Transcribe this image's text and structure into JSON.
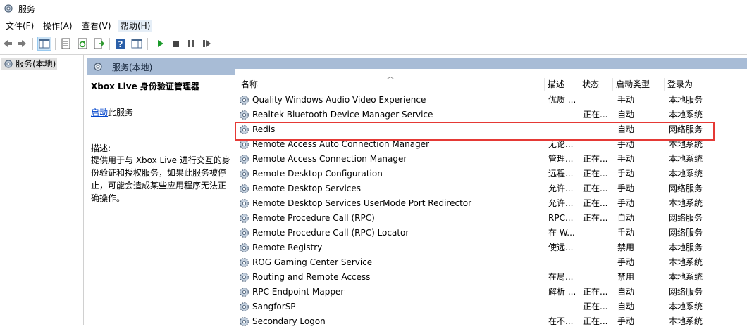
{
  "window": {
    "title": "服务"
  },
  "menu": [
    {
      "label": "文件(F)"
    },
    {
      "label": "操作(A)"
    },
    {
      "label": "查看(V)"
    },
    {
      "label": "帮助(H)"
    }
  ],
  "toolbar": {
    "icons": [
      "back-arrow-icon",
      "forward-arrow-icon",
      "console-tree-icon",
      "properties-icon",
      "refresh-icon",
      "export-list-icon",
      "help-icon",
      "show-pane-icon",
      "start-icon",
      "stop-icon",
      "pause-icon",
      "restart-icon"
    ]
  },
  "tree": {
    "item_label": "服务(本地)"
  },
  "main_header": {
    "label": "服务(本地)"
  },
  "description_panel": {
    "service_title": "Xbox Live 身份验证管理器",
    "start_link": "启动",
    "start_suffix": "此服务",
    "desc_label": "描述:",
    "desc_text": "提供用于与 Xbox Live 进行交互的身份验证和授权服务，如果此服务被停止，可能会造成某些应用程序无法正确操作。"
  },
  "columns": {
    "name": "名称",
    "desc": "描述",
    "status": "状态",
    "startup": "启动类型",
    "logon": "登录为"
  },
  "services": [
    {
      "name": "Quality Windows Audio Video Experience",
      "desc": "优质 ...",
      "status": "",
      "startup": "手动",
      "logon": "本地服务"
    },
    {
      "name": "Realtek Bluetooth Device Manager Service",
      "desc": "",
      "status": "正在...",
      "startup": "自动",
      "logon": "本地系统"
    },
    {
      "name": "Redis",
      "desc": "",
      "status": "",
      "startup": "自动",
      "logon": "网络服务"
    },
    {
      "name": "Remote Access Auto Connection Manager",
      "desc": "无论...",
      "status": "",
      "startup": "手动",
      "logon": "本地系统"
    },
    {
      "name": "Remote Access Connection Manager",
      "desc": "管理...",
      "status": "正在...",
      "startup": "手动",
      "logon": "本地系统"
    },
    {
      "name": "Remote Desktop Configuration",
      "desc": "远程...",
      "status": "正在...",
      "startup": "手动",
      "logon": "本地系统"
    },
    {
      "name": "Remote Desktop Services",
      "desc": "允许...",
      "status": "正在...",
      "startup": "手动",
      "logon": "网络服务"
    },
    {
      "name": "Remote Desktop Services UserMode Port Redirector",
      "desc": "允许...",
      "status": "正在...",
      "startup": "手动",
      "logon": "本地系统"
    },
    {
      "name": "Remote Procedure Call (RPC)",
      "desc": "RPC...",
      "status": "正在...",
      "startup": "自动",
      "logon": "网络服务"
    },
    {
      "name": "Remote Procedure Call (RPC) Locator",
      "desc": "在 W...",
      "status": "",
      "startup": "手动",
      "logon": "网络服务"
    },
    {
      "name": "Remote Registry",
      "desc": "使远...",
      "status": "",
      "startup": "禁用",
      "logon": "本地服务"
    },
    {
      "name": "ROG Gaming Center Service",
      "desc": "",
      "status": "",
      "startup": "手动",
      "logon": "本地系统"
    },
    {
      "name": "Routing and Remote Access",
      "desc": "在局...",
      "status": "",
      "startup": "禁用",
      "logon": "本地系统"
    },
    {
      "name": "RPC Endpoint Mapper",
      "desc": "解析 ...",
      "status": "正在...",
      "startup": "自动",
      "logon": "网络服务"
    },
    {
      "name": "SangforSP",
      "desc": "",
      "status": "正在...",
      "startup": "自动",
      "logon": "本地系统"
    },
    {
      "name": "Secondary Logon",
      "desc": "在不...",
      "status": "正在...",
      "startup": "手动",
      "logon": "本地系统"
    }
  ],
  "highlighted_service": "Redis",
  "colors": {
    "highlight_border": "#e53935",
    "pane_header": "#a8bcd6",
    "link": "#0044cc"
  }
}
